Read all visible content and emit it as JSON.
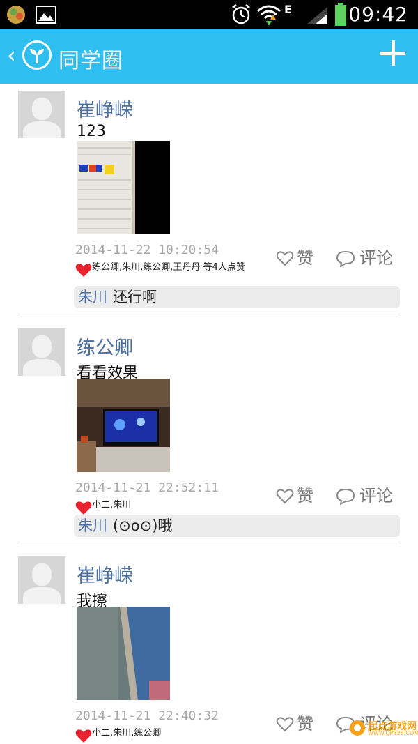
{
  "status_bar": {
    "time": "09:42",
    "network": "E"
  },
  "header": {
    "title": "同学圈"
  },
  "actions": {
    "like_label": "赞",
    "comment_label": "评论"
  },
  "posts": [
    {
      "author": "崔峥嵘",
      "content": "123",
      "timestamp": "2014-11-22 10:20:54",
      "likers": "练公卿,朱川,练公卿,王丹丹 等4人点赞",
      "comment_author": "朱川",
      "comment_text": "还行啊"
    },
    {
      "author": "练公卿",
      "content": "看看效果",
      "timestamp": "2014-11-21 22:52:11",
      "likers": "小二,朱川",
      "comment_author": "朱川",
      "comment_text": "(⊙o⊙)哦"
    },
    {
      "author": "崔峥嵘",
      "content": "我擦",
      "timestamp": "2014-11-21 22:40:32",
      "likers": "小二,朱川,练公卿"
    }
  ],
  "watermark": {
    "text": "起点游戏网",
    "sub": "WWW.QP828.COM"
  },
  "colors": {
    "app_bar": "#2ebef0",
    "name": "#4a6fa0",
    "like_heart": "#e8232e"
  }
}
